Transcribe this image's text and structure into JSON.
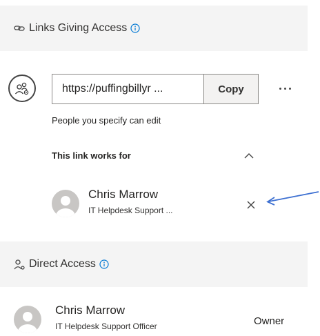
{
  "links_section": {
    "title": "Links Giving Access",
    "link_url": "https://puffingbillyr ...",
    "copy_label": "Copy",
    "permission_text": "People you specify can edit",
    "works_for_label": "This link works for",
    "people": [
      {
        "name": "Chris Marrow",
        "role": "IT Helpdesk Support ..."
      }
    ]
  },
  "direct_section": {
    "title": "Direct Access",
    "people": [
      {
        "name": "Chris Marrow",
        "role": "IT Helpdesk Support Officer",
        "permission": "Owner"
      }
    ]
  },
  "colors": {
    "header_bg": "#f4f4f4",
    "info_accent": "#0078d4",
    "annotation_arrow": "#3c6fd1",
    "avatar_bg": "#c8c6c4"
  },
  "icons": [
    "link-icon",
    "info-icon",
    "people-settings-icon",
    "more-options-icon",
    "chevron-up-icon",
    "close-icon",
    "person-icon"
  ]
}
